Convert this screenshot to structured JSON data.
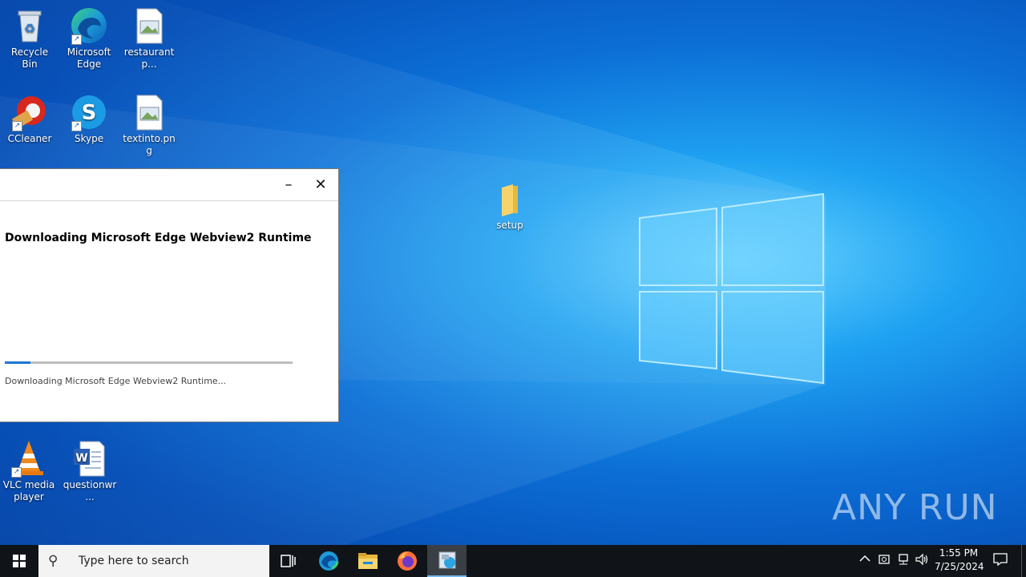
{
  "desktop": {
    "icons": [
      {
        "label": "Recycle Bin",
        "icon": "recycle-bin-icon"
      },
      {
        "label": "Microsoft Edge",
        "icon": "edge-icon"
      },
      {
        "label": "restaurantp...",
        "icon": "image-file-icon"
      },
      {
        "label": "CCleaner",
        "icon": "ccleaner-icon"
      },
      {
        "label": "Skype",
        "icon": "skype-icon"
      },
      {
        "label": "textinto.png",
        "icon": "image-file-icon"
      },
      {
        "label": "setup",
        "icon": "folder-icon"
      },
      {
        "label": "VLC media player",
        "icon": "vlc-icon"
      },
      {
        "label": "questionwr...",
        "icon": "word-document-icon"
      }
    ]
  },
  "installer_window": {
    "heading": "Downloading Microsoft Edge Webview2 Runtime",
    "status": "Downloading Microsoft Edge Webview2 Runtime...",
    "progress_fraction": 0.09,
    "minimize_label": "–",
    "close_label": "✕"
  },
  "taskbar": {
    "search_placeholder": "Type here to search",
    "time": "1:55 PM",
    "date": "7/25/2024",
    "pinned": [
      "task-view-icon",
      "edge-icon",
      "file-explorer-icon",
      "firefox-icon",
      "installer-icon"
    ]
  },
  "watermark": "ANY RUN",
  "colors": {
    "accent": "#1976d2",
    "taskbar": "#101418",
    "desktop": "#0c6fd6"
  }
}
